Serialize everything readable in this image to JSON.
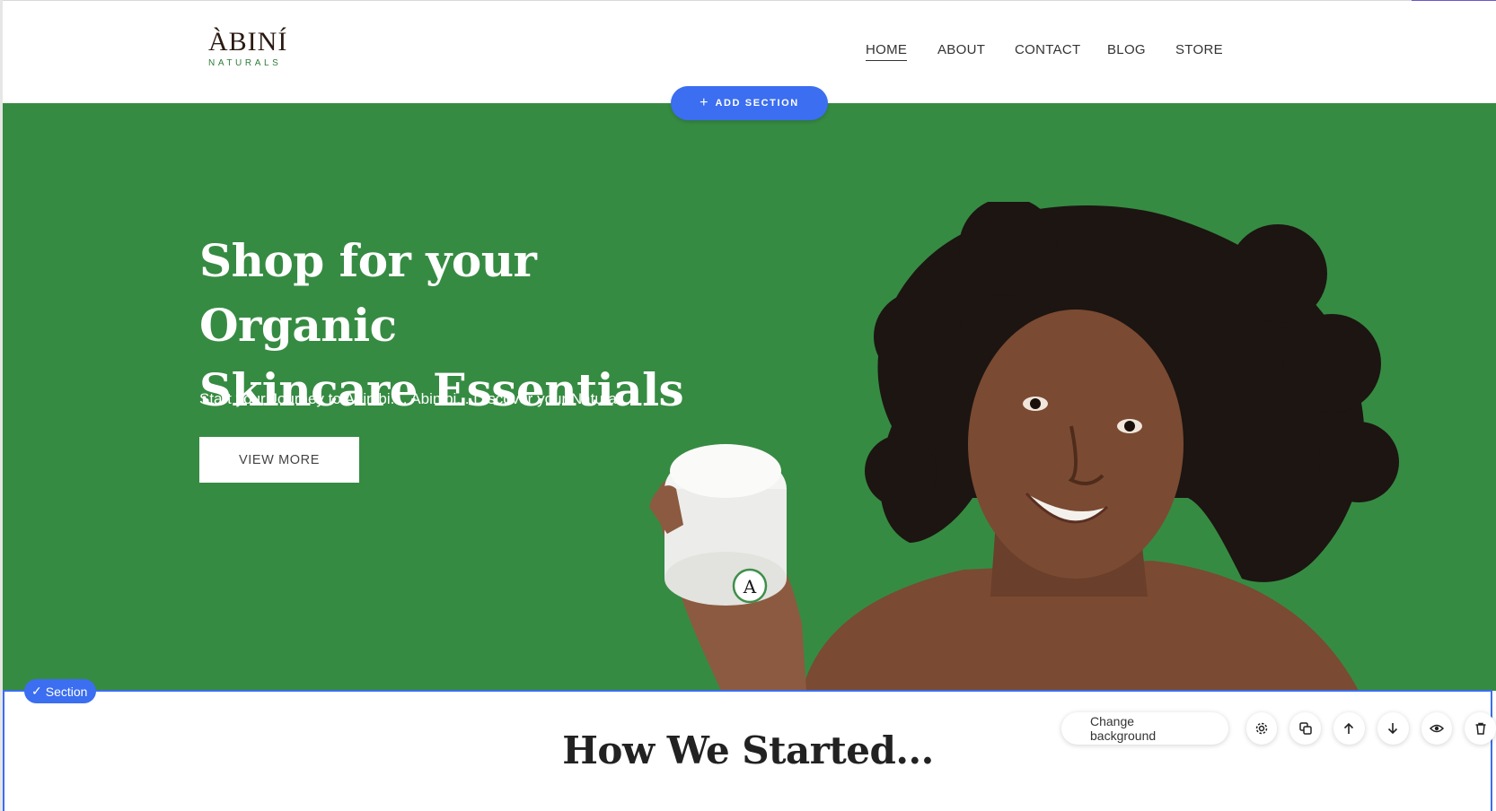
{
  "brand": {
    "logo_main": "ÀBINÍ",
    "logo_sub": "NATURALS",
    "accent_color": "#368b42",
    "editor_color": "#3b6ef0"
  },
  "nav": {
    "items": [
      {
        "label": "HOME",
        "active": true
      },
      {
        "label": "ABOUT",
        "active": false
      },
      {
        "label": "CONTACT",
        "active": false
      },
      {
        "label": "BLOG",
        "active": false
      },
      {
        "label": "STORE",
        "active": false
      }
    ]
  },
  "editor": {
    "add_section_label": "ADD SECTION",
    "section_badge_label": "Section",
    "change_background_label": "Change background",
    "toolbar_icons": [
      "gear-icon",
      "duplicate-icon",
      "arrow-up-icon",
      "arrow-down-icon",
      "eye-icon",
      "trash-icon"
    ]
  },
  "hero": {
    "title_line1": "Shop for your Organic",
    "title_line2": "Skincare Essentials",
    "subtitle": "Start your Journey to Abinibi.... Abinibi... Discover your Natural",
    "button_label": "VIEW MORE",
    "jar_letter": "A"
  },
  "section2": {
    "title": "How We Started..."
  }
}
